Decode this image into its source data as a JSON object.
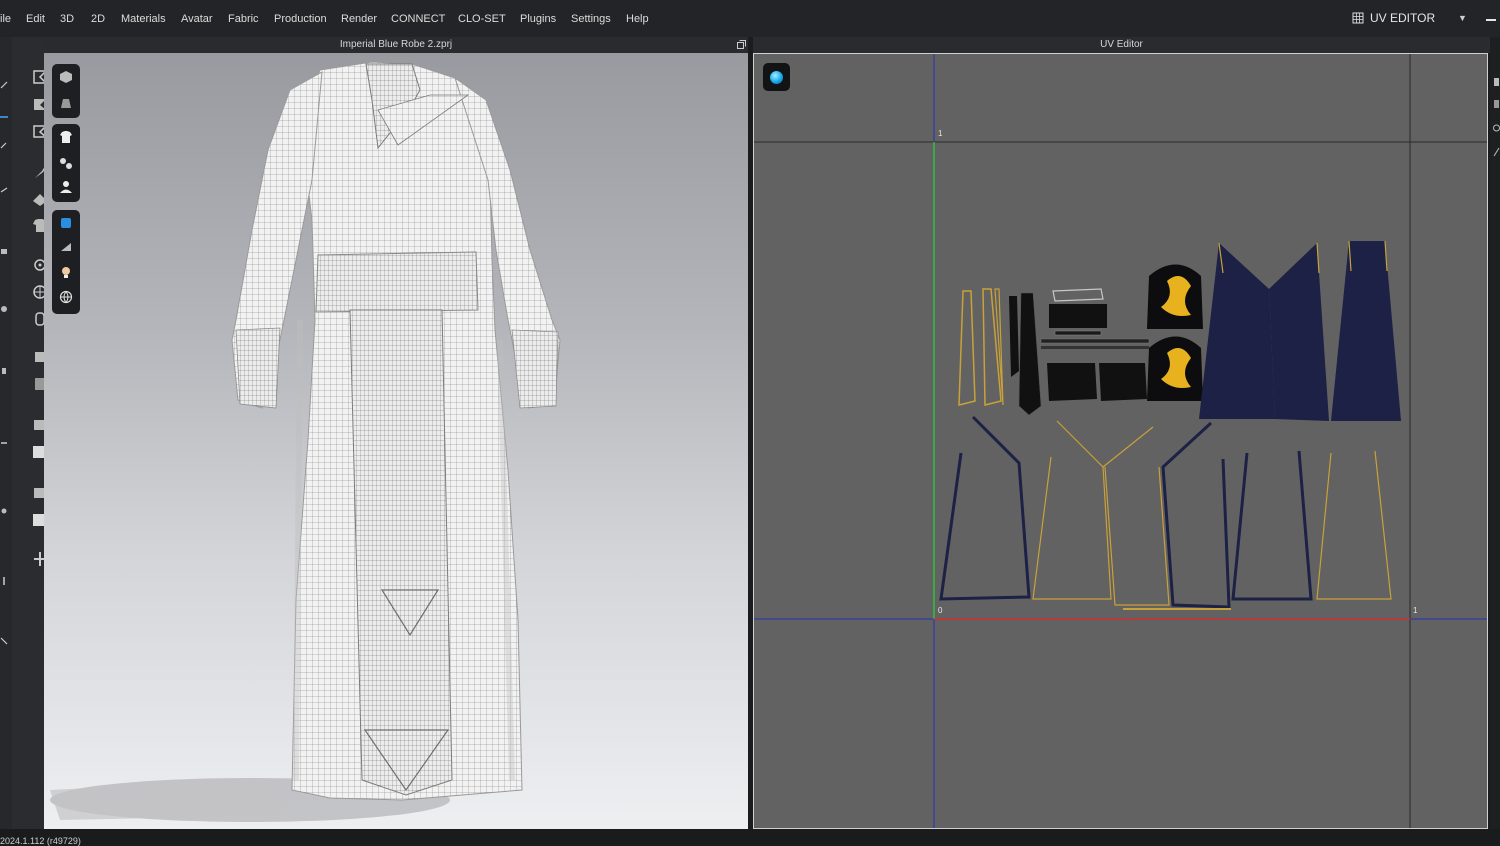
{
  "menu": {
    "items": [
      "ile",
      "Edit",
      "3D",
      "2D",
      "Materials",
      "Avatar",
      "Fabric",
      "Production",
      "Render",
      "CONNECT",
      "CLO-SET",
      "Plugins",
      "Settings",
      "Help"
    ],
    "workspace_label": "UV EDITOR",
    "workspace_icon": "uv-grid-icon"
  },
  "window3d": {
    "title": "Imperial Blue Robe 2.zprj"
  },
  "uv_editor": {
    "title": "UV Editor",
    "axis_labels": {
      "top_v": "1",
      "origin": "0",
      "right_u": "1"
    },
    "colors": {
      "u_axis": "#d03030",
      "v_axis": "#2fc23a",
      "guide": "#2a2fb5",
      "trim": "#c9a13a",
      "navy": "#1c2145"
    }
  },
  "status": {
    "version": "2024.1.112 (r49729)"
  }
}
